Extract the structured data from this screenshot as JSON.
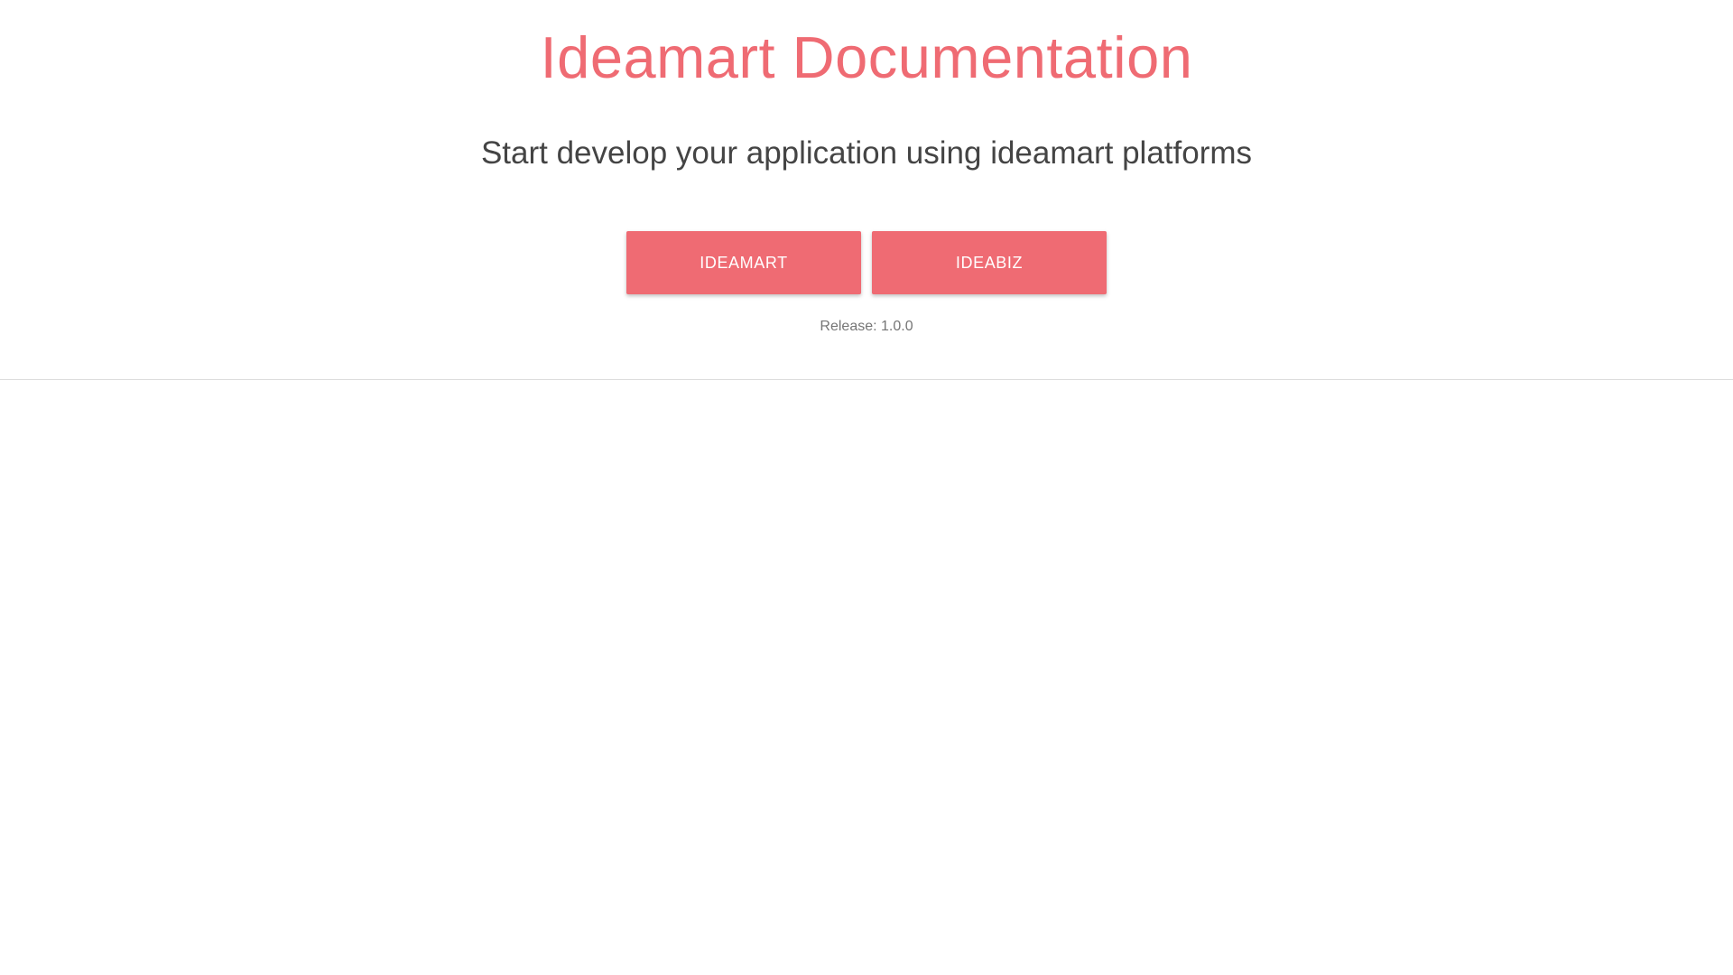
{
  "header": {
    "title": "Ideamart Documentation",
    "subtitle": "Start develop your application using ideamart platforms"
  },
  "actions": {
    "ideamart_label": "IDEAMART",
    "ideabiz_label": "IDEABIZ"
  },
  "footer": {
    "release_text": "Release: 1.0.0"
  },
  "colors": {
    "accent": "#ef6b73",
    "subtitle_text": "#444444",
    "muted_text": "#757575",
    "divider": "#dcdcdc"
  }
}
